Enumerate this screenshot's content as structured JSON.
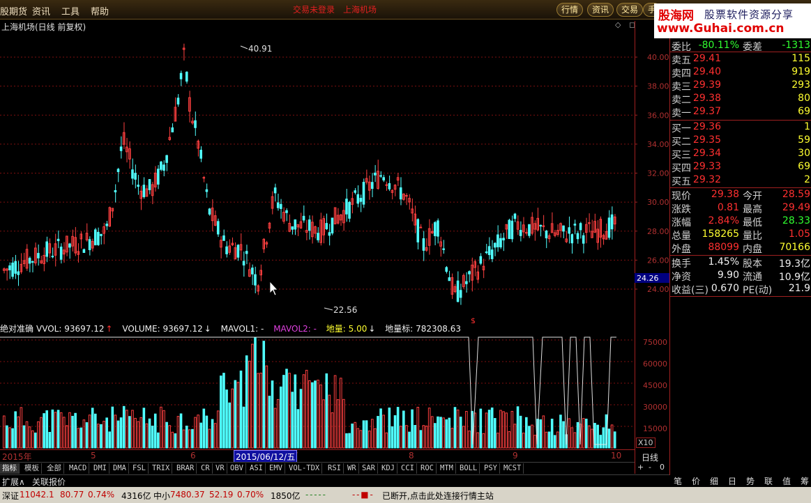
{
  "menu": {
    "items": [
      "股期货",
      "资讯",
      "工具",
      "帮助"
    ],
    "center": [
      "交易未登录",
      "上海机场"
    ],
    "tabs": [
      "行情",
      "资讯",
      "交易",
      "手"
    ]
  },
  "logo": {
    "brand": "股海网",
    "tagline": "股票软件资源分享",
    "url": "www.Guhai.com.cn"
  },
  "chart": {
    "title": "上海机场(日线 前复权)",
    "icons": "◇ ◻",
    "price_ticks": [
      "40.00",
      "38.00",
      "36.00",
      "34.00",
      "32.00",
      "30.00",
      "28.00",
      "26.00",
      "24.00"
    ],
    "current_price_tag": "24.26",
    "high_label": "40.91",
    "low_label": "22.56",
    "marker": "$"
  },
  "indicator_line": {
    "name": "绝对准确",
    "vvol": "VVOL: 93697.12",
    "volume": "VOLUME: 93697.12",
    "mavol1": "MAVOL1: -",
    "mavol2": "MAVOL2: -",
    "diliang": "地量: 5.00",
    "diliangbiao": "地量标: 782308.63"
  },
  "vol_ticks": [
    "75000",
    "60000",
    "45000",
    "30000",
    "15000"
  ],
  "vol_scale": "X10",
  "xaxis": {
    "labels": [
      "2015年",
      "5",
      "6",
      "7",
      "8",
      "9",
      "10"
    ],
    "date_box": "2015/06/12/五",
    "period": "日线"
  },
  "indicator_tabs": [
    "指标",
    "模板",
    "全部",
    "MACD",
    "DMI",
    "DMA",
    "FSL",
    "TRIX",
    "BRAR",
    "CR",
    "VR",
    "OBV",
    "ASI",
    "EMV",
    "VOL-TDX",
    "RSI",
    "WR",
    "SAR",
    "KDJ",
    "CCI",
    "ROC",
    "MTM",
    "BOLL",
    "PSY",
    "MCST"
  ],
  "zoom_buttons": [
    "+",
    "-",
    "0"
  ],
  "bottom_left": [
    "扩展∧",
    "关联报价"
  ],
  "quote": {
    "weibi": {
      "label": "委比",
      "value": "-80.11%",
      "label2": "委差",
      "value2": "-1313"
    },
    "sell": [
      {
        "label": "卖五",
        "price": "29.41",
        "vol": "115"
      },
      {
        "label": "卖四",
        "price": "29.40",
        "vol": "919"
      },
      {
        "label": "卖三",
        "price": "29.39",
        "vol": "293"
      },
      {
        "label": "卖二",
        "price": "29.38",
        "vol": "80"
      },
      {
        "label": "卖一",
        "price": "29.37",
        "vol": "69"
      }
    ],
    "buy": [
      {
        "label": "买一",
        "price": "29.36",
        "vol": "1"
      },
      {
        "label": "买二",
        "price": "29.35",
        "vol": "59"
      },
      {
        "label": "买三",
        "price": "29.34",
        "vol": "30"
      },
      {
        "label": "买四",
        "price": "29.33",
        "vol": "69"
      },
      {
        "label": "买五",
        "price": "29.32",
        "vol": "2"
      }
    ],
    "stats": [
      {
        "l1": "现价",
        "v1": "29.38",
        "c1": "red",
        "l2": "今开",
        "v2": "28.59",
        "c2": "red"
      },
      {
        "l1": "涨跌",
        "v1": "0.81",
        "c1": "red",
        "l2": "最高",
        "v2": "29.49",
        "c2": "red"
      },
      {
        "l1": "涨幅",
        "v1": "2.84%",
        "c1": "red",
        "l2": "最低",
        "v2": "28.33",
        "c2": "green"
      },
      {
        "l1": "总量",
        "v1": "158265",
        "c1": "yellow",
        "l2": "量比",
        "v2": "1.05",
        "c2": "red"
      },
      {
        "l1": "外盘",
        "v1": "88099",
        "c1": "red",
        "l2": "内盘",
        "v2": "70166",
        "c2": "yellow"
      }
    ],
    "stats2": [
      {
        "l1": "换手",
        "v1": "1.45%",
        "l2": "股本",
        "v2": "19.3亿"
      },
      {
        "l1": "净资",
        "v1": "9.90",
        "l2": "流通",
        "v2": "10.9亿"
      },
      {
        "l1": "收益(三)",
        "v1": "0.670",
        "l2": "PE(动)",
        "v2": "21.9"
      }
    ]
  },
  "right_tabs": [
    "笔",
    "价",
    "细",
    "日",
    "势",
    "联",
    "值",
    "筹"
  ],
  "statusbar": {
    "sz_label": "深证",
    "sz_index": "11042.1",
    "sz_change": "80.77",
    "sz_pct": "0.74%",
    "sz_amount": "4316亿",
    "zx_label": "中小",
    "zx_index": "7480.37",
    "zx_change": "52.19",
    "zx_pct": "0.70%",
    "zx_amount": "1850亿",
    "message": "已断开,点击此处连接行情主站"
  }
}
